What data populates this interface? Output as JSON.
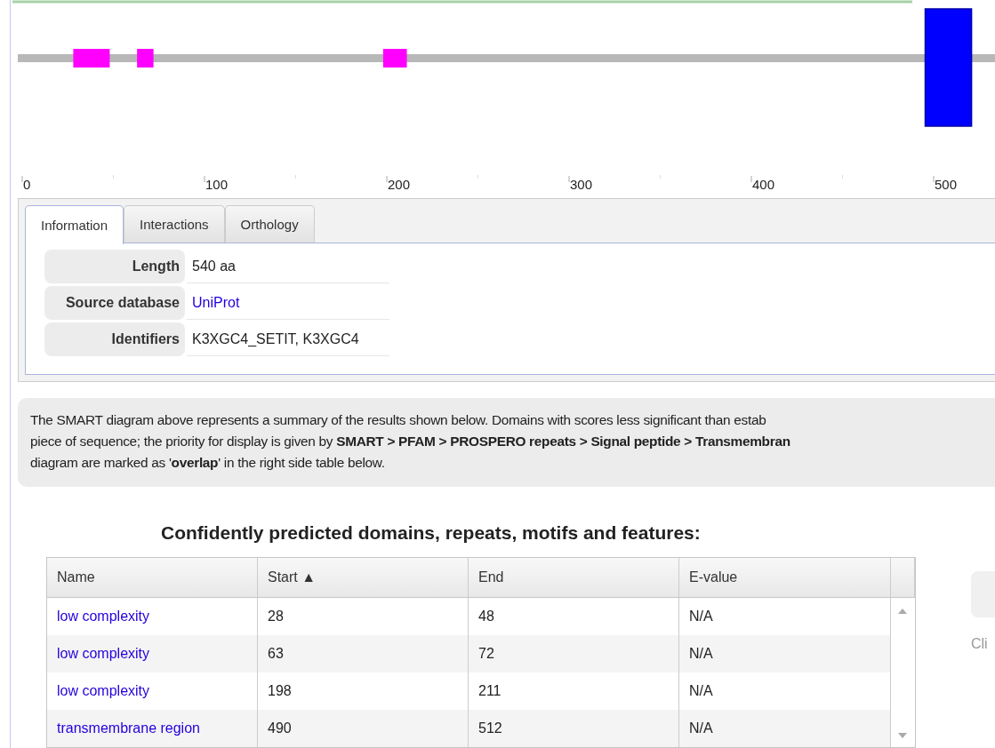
{
  "diagram": {
    "scale": [
      "0",
      "100",
      "200",
      "300",
      "400",
      "500"
    ]
  },
  "tabs": [
    {
      "label": "Information",
      "selected": true
    },
    {
      "label": "Interactions",
      "selected": false
    },
    {
      "label": "Orthology",
      "selected": false
    }
  ],
  "info": [
    {
      "label": "Length",
      "value": "540 aa",
      "kind": "text"
    },
    {
      "label": "Source database",
      "value": "UniProt",
      "kind": "link"
    },
    {
      "label": "Identifiers",
      "value": "K3XGC4_SETIT, K3XGC4",
      "kind": "text"
    }
  ],
  "summary": "The SMART diagram above represents a summary of the results shown below. Domains with scores less significant than estab\npiece of sequence; the priority for display is given by **SMART > PFAM > PROSPERO repeats > Signal peptide > Transmembran**\ndiagram are marked as '**overlap**' in the right side table below.",
  "table": {
    "title": "Confidently predicted domains, repeats, motifs and features:",
    "columns": [
      "Name",
      "Start ▲",
      "End",
      "E-value"
    ],
    "rows": [
      {
        "name": "low complexity",
        "start": "28",
        "end": "48",
        "evalue": "N/A",
        "kind": "lowcomplexity",
        "color": "#ff00ff"
      },
      {
        "name": "low complexity",
        "start": "63",
        "end": "72",
        "evalue": "N/A",
        "kind": "lowcomplexity",
        "color": "#ff00ff"
      },
      {
        "name": "low complexity",
        "start": "198",
        "end": "211",
        "evalue": "N/A",
        "kind": "lowcomplexity",
        "color": "#ff00ff"
      },
      {
        "name": "transmembrane region",
        "start": "490",
        "end": "512",
        "evalue": "N/A",
        "kind": "transmembrane",
        "color": "#0000ff"
      }
    ]
  },
  "side_note": "Cli"
}
